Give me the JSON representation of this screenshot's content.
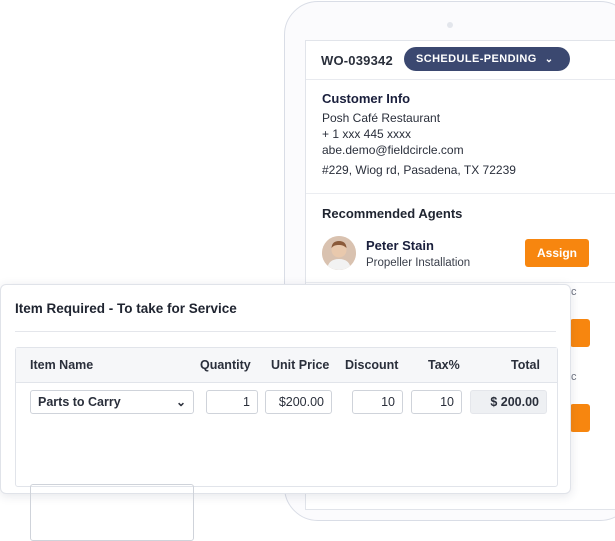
{
  "work_order": {
    "number": "WO-039342",
    "status": "SCHEDULE-PENDING"
  },
  "customer_info": {
    "title": "Customer Info",
    "name": "Posh Café Restaurant",
    "phone": "+ 1 xxx 445 xxxx",
    "email": "abe.demo@fieldcircle.com",
    "address": "#229, Wiog rd, Pasadena, TX 72239"
  },
  "recommended_agents": {
    "title": "Recommended Agents",
    "agents": [
      {
        "name": "Peter Stain",
        "role": "Propeller Installation",
        "action": "Assign"
      }
    ],
    "partial_buttons": [
      "n",
      "n"
    ],
    "partial_text": [
      "c",
      "c"
    ]
  },
  "item_required": {
    "title": "Item Required - To take for Service",
    "columns": [
      "Item Name",
      "Quantity",
      "Unit Price",
      "Discount",
      "Tax%",
      "Total"
    ],
    "row": {
      "item": "Parts to Carry",
      "quantity": "1",
      "unit_price": "$200.00",
      "discount": "10",
      "tax": "10",
      "total": "$ 200.00"
    }
  },
  "colors": {
    "status_pill": "#3b4870",
    "assign_button": "#f7860f"
  },
  "icons": [
    "chevron-down-icon",
    "avatar"
  ]
}
